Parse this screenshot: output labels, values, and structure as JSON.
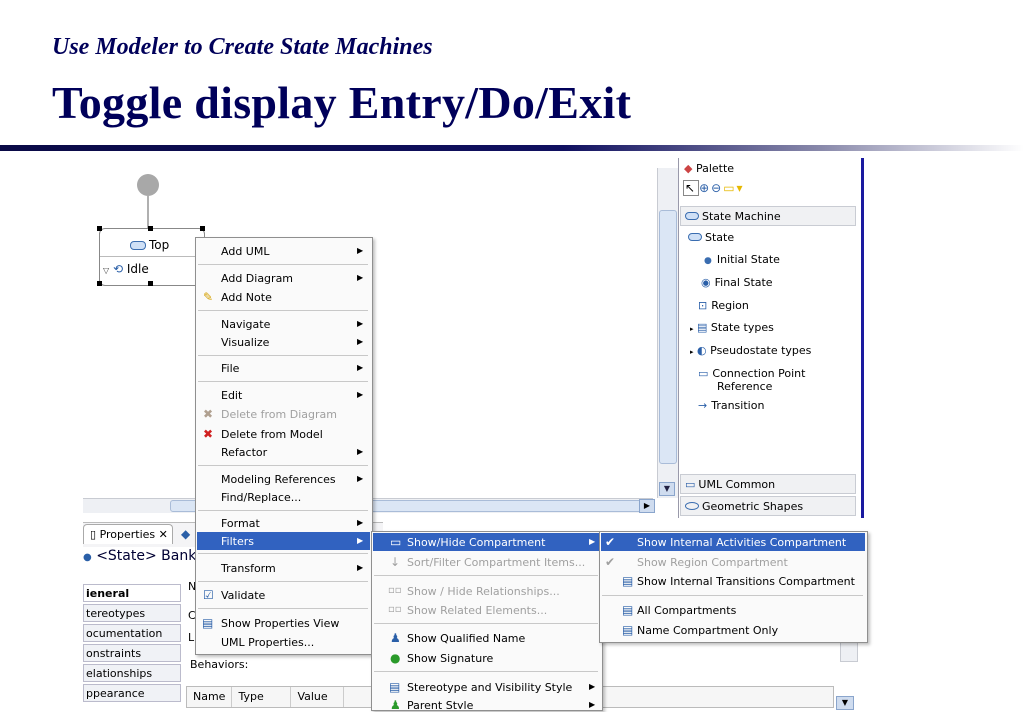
{
  "slide": {
    "subtitle": "Use Modeler to Create State Machines",
    "title": "Toggle display Entry/Do/Exit"
  },
  "diagram": {
    "state_top": "Top",
    "state_idle": "Idle"
  },
  "palette": {
    "header": "Palette",
    "drawer_state_machine": "State Machine",
    "items": [
      "State",
      "Initial State",
      "Final State",
      "Region",
      "State types",
      "Pseudostate types",
      "Connection Point",
      "Reference",
      "Transition"
    ],
    "drawer_uml_common": "UML Common",
    "drawer_geometric": "Geometric Shapes"
  },
  "properties": {
    "tab": "Properties",
    "header": "<State> Banki",
    "side_general": "ieneral",
    "side_items": [
      "tereotypes",
      "ocumentation",
      "onstraints",
      "elationships",
      "ppearance"
    ],
    "main_letters": [
      "N",
      "C",
      "L"
    ],
    "behaviors": "Behaviors:",
    "table_cols": [
      "Name",
      "Type",
      "Value"
    ]
  },
  "context_menu": {
    "items": [
      "Add UML",
      "Add Diagram",
      "Add Note",
      "Navigate",
      "Visualize",
      "File",
      "Edit",
      "Delete from Diagram",
      "Delete from Model",
      "Refactor",
      "Modeling References",
      "Find/Replace...",
      "Format",
      "Filters",
      "Transform",
      "Validate",
      "Show Properties View",
      "UML Properties..."
    ]
  },
  "filters_menu": {
    "items": [
      "Show/Hide Compartment",
      "Sort/Filter Compartment Items...",
      "Show / Hide Relationships...",
      "Show Related Elements...",
      "Show Qualified Name",
      "Show Signature",
      "Stereotype and Visibility Style",
      "Parent Style"
    ]
  },
  "compartment_menu": {
    "items": [
      "Show Internal Activities Compartment",
      "Show Region Compartment",
      "Show Internal Transitions Compartment",
      "All Compartments",
      "Name Compartment Only"
    ]
  },
  "colors": {
    "title": "#00005a",
    "highlight": "#3162c0",
    "palette_border": "#1a1aa0"
  }
}
